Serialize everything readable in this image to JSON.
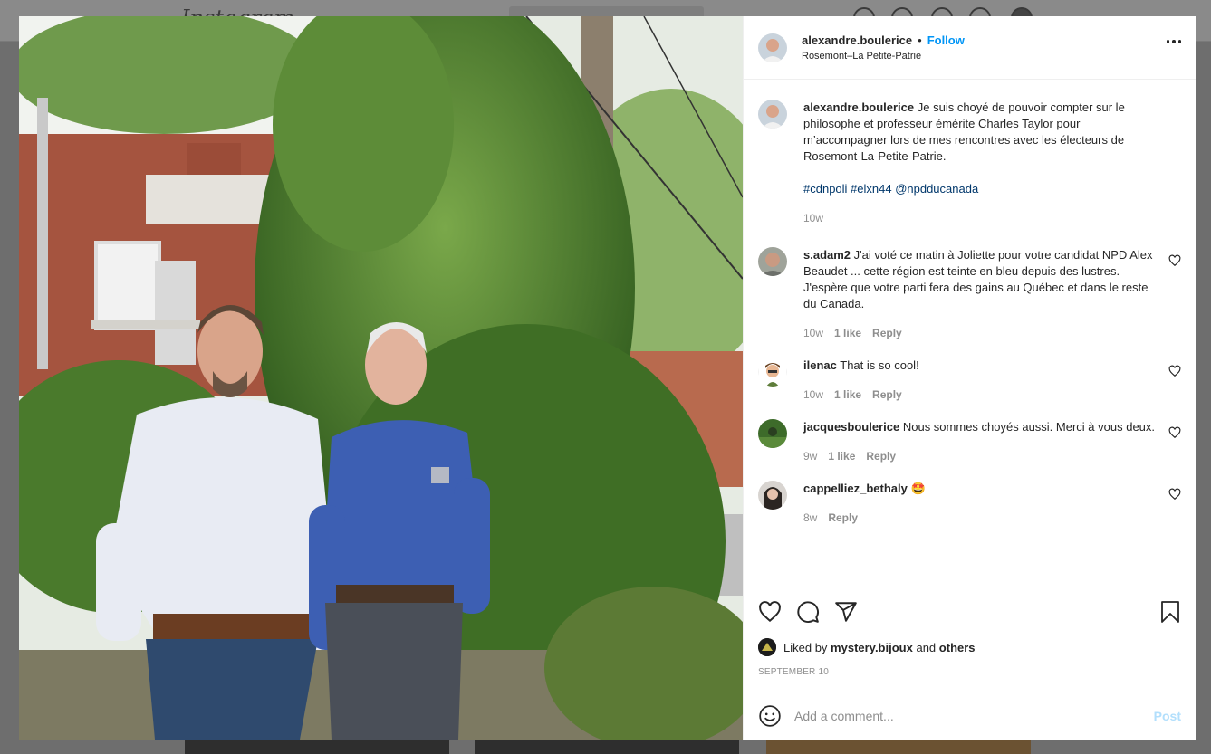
{
  "background": {
    "logo_text": "Instagram"
  },
  "post": {
    "header": {
      "username": "alexandre.boulerice",
      "follow_label": "Follow",
      "separator": "•",
      "location": "Rosemont–La Petite-Patrie",
      "more_icon": "more-horizontal-icon"
    },
    "caption": {
      "username": "alexandre.boulerice",
      "text": "Je suis choyé de pouvoir compter sur le philosophe et professeur émérite Charles Taylor pour m’accompagner lors de mes rencontres avec les électeurs de Rosemont-La-Petite-Patrie.",
      "hashtags": "#cdnpoli #elxn44 @npdducanada",
      "time": "10w"
    },
    "comments": [
      {
        "username": "s.adam2",
        "text": "J'ai voté ce matin à Joliette pour votre candidat NPD Alex Beaudet ... cette région est teinte en bleu depuis des lustres. J'espère que votre parti fera des gains au Québec et dans le reste du Canada.",
        "time": "10w",
        "likes": "1 like",
        "reply": "Reply"
      },
      {
        "username": "ilenac",
        "text": "That is so cool!",
        "time": "10w",
        "likes": "1 like",
        "reply": "Reply"
      },
      {
        "username": "jacquesboulerice",
        "text": "Nous sommes choyés aussi. Merci à vous deux.",
        "time": "9w",
        "likes": "1 like",
        "reply": "Reply"
      },
      {
        "username": "cappelliez_bethaly",
        "text": "🤩",
        "time": "8w",
        "likes": "",
        "reply": "Reply"
      }
    ],
    "actions": {
      "like_icon": "heart-icon",
      "comment_icon": "comment-bubble-icon",
      "share_icon": "paper-plane-icon",
      "save_icon": "bookmark-icon"
    },
    "likes": {
      "prefix": "Liked by",
      "user": "mystery.bijoux",
      "and": "and",
      "others": "others"
    },
    "date": "SEPTEMBER 10",
    "add_comment": {
      "placeholder": "Add a comment...",
      "post_label": "Post",
      "emoji_icon": "smiley-icon"
    }
  },
  "colors": {
    "accent": "#0095f6",
    "hashtag": "#00376b",
    "muted": "#8e8e8e",
    "post_disabled": "#b2dffc"
  }
}
